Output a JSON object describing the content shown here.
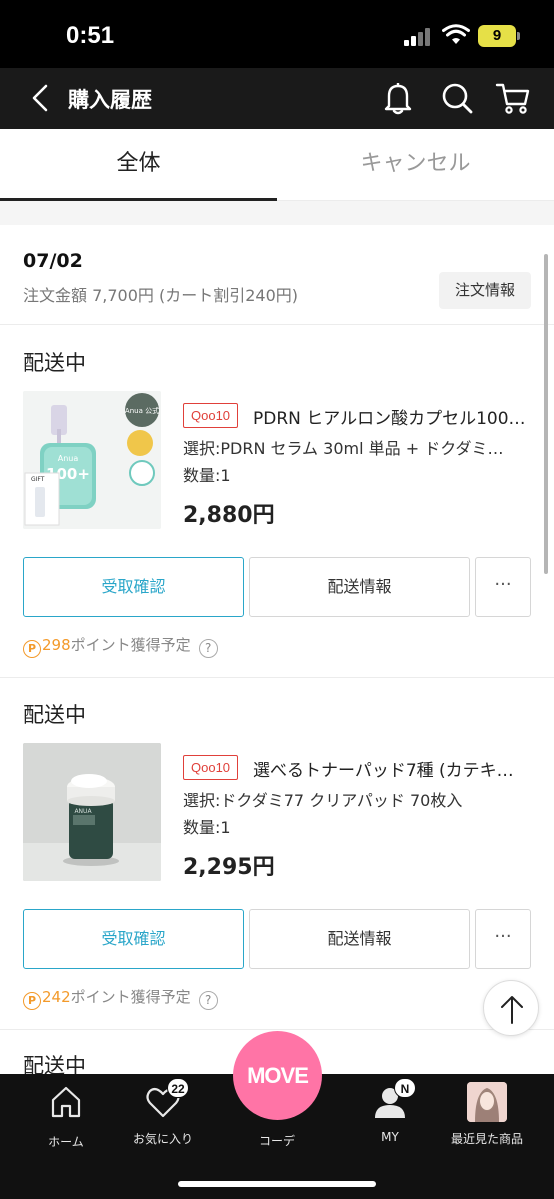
{
  "status_bar": {
    "time": "0:51",
    "battery": "9"
  },
  "header": {
    "title": "購入履歴"
  },
  "tabs": [
    {
      "label": "全体",
      "active": true
    },
    {
      "label": "キャンセル",
      "active": false
    }
  ],
  "order": {
    "date": "07/02",
    "total": "注文金額 7,700円 (カート割引240円)",
    "info_button": "注文情報"
  },
  "items": [
    {
      "status": "配送中",
      "seller_badge": "Qoo10",
      "name": "PDRN ヒアルロン酸カプセル100…",
      "option": "選択:PDRN セラム 30ml 単品 + ドクダミ…",
      "quantity": "数量:1",
      "price": "2,880円",
      "receive_button": "受取確認",
      "shipping_button": "配送情報",
      "more_button": "···",
      "points_icon": "P",
      "points": "298",
      "points_text": "ポイント獲得予定",
      "help": "?",
      "image_text": {
        "brand": "Anua",
        "hero": "100+",
        "badge": "Anua 公式",
        "gift": "GIFT"
      }
    },
    {
      "status": "配送中",
      "seller_badge": "Qoo10",
      "name": "選べるトナーパッド7種 (カテキ…",
      "option": "選択:ドクダミ77 クリアパッド 70枚入",
      "quantity": "数量:1",
      "price": "2,295円",
      "receive_button": "受取確認",
      "shipping_button": "配送情報",
      "more_button": "···",
      "points_icon": "P",
      "points": "242",
      "points_text": "ポイント獲得予定",
      "help": "?",
      "image_text": {
        "brand": "ANUA"
      }
    }
  ],
  "partial_item": {
    "status": "配送中"
  },
  "bottom_nav": {
    "items": [
      {
        "label": "ホーム",
        "icon": "home-icon"
      },
      {
        "label": "お気に入り",
        "icon": "heart-icon",
        "badge": "22"
      },
      {
        "label": "コーデ",
        "icon": "move-icon"
      },
      {
        "label": "MY",
        "icon": "user-icon",
        "badge": "N"
      },
      {
        "label": "最近見た商品",
        "icon": "recent-product-thumbnail"
      }
    ],
    "center_button": "MOVE"
  },
  "colors": {
    "accent_blue": "#2aa6c9",
    "seller_red": "#e0403a",
    "points_orange": "#f39a2b",
    "move_pink": "#ff74a6",
    "header_bg": "#1a1a1a"
  }
}
